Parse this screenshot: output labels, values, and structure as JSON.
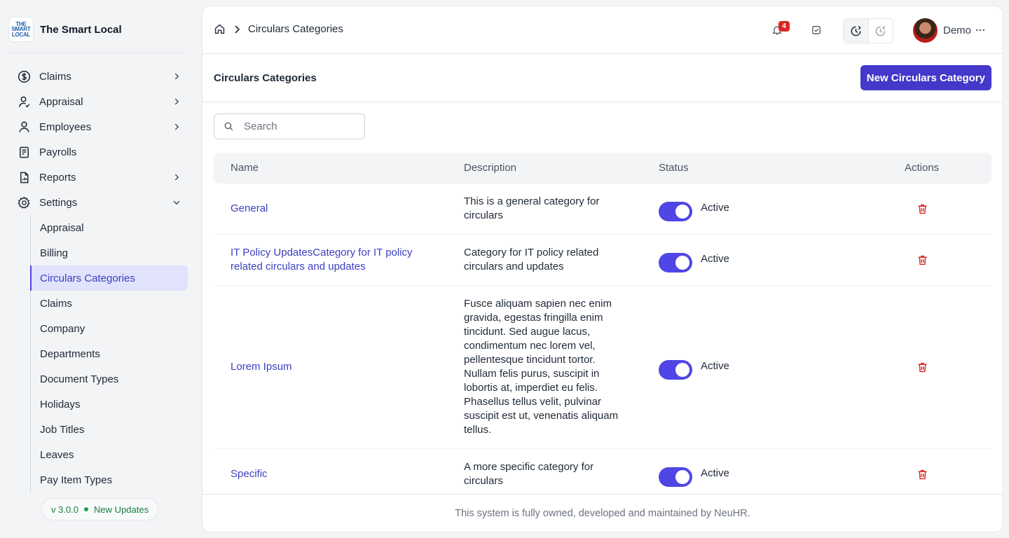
{
  "brand": {
    "logo_text": [
      "THE",
      "SMART",
      "LOCAL"
    ],
    "name": "The Smart Local"
  },
  "sidebar": {
    "items": [
      {
        "label": "Claims",
        "icon": "dollar-circle-icon",
        "chevron": "right"
      },
      {
        "label": "Appraisal",
        "icon": "user-check-icon",
        "chevron": "right"
      },
      {
        "label": "Employees",
        "icon": "user-icon",
        "chevron": "right"
      },
      {
        "label": "Payrolls",
        "icon": "receipt-icon",
        "chevron": ""
      },
      {
        "label": "Reports",
        "icon": "report-file-icon",
        "chevron": "right"
      },
      {
        "label": "Settings",
        "icon": "gear-icon",
        "chevron": "down"
      }
    ],
    "settings_children": [
      "Appraisal",
      "Billing",
      "Circulars Categories",
      "Claims",
      "Company",
      "Departments",
      "Document Types",
      "Holidays",
      "Job Titles",
      "Leaves",
      "Pay Item Types"
    ],
    "active_child": "Circulars Categories",
    "version": "v 3.0.0",
    "updates_label": "New Updates"
  },
  "topbar": {
    "breadcrumb": "Circulars Categories",
    "notification_count": "4",
    "user_name": "Demo"
  },
  "page": {
    "title": "Circulars Categories",
    "new_button": "New Circulars Category",
    "search_placeholder": "Search"
  },
  "table": {
    "columns": [
      "Name",
      "Description",
      "Status",
      "Actions"
    ],
    "rows": [
      {
        "name": "General",
        "description": "This is a general category for circulars",
        "status": "Active"
      },
      {
        "name": "IT Policy UpdatesCategory for IT policy related circulars and updates",
        "description": "Category for IT policy related circulars and updates",
        "status": "Active"
      },
      {
        "name": "Lorem Ipsum",
        "description": "Fusce aliquam sapien nec enim gravida, egestas fringilla enim tincidunt. Sed augue lacus, condimentum nec lorem vel, pellentesque tincidunt tortor. Nullam felis purus, suscipit in lobortis at, imperdiet eu felis. Phasellus tellus velit, pulvinar suscipit est ut, venenatis aliquam tellus.",
        "status": "Active"
      },
      {
        "name": "Specific",
        "description": "A more specific category for circulars",
        "status": "Active"
      }
    ]
  },
  "footer": {
    "text": "This system is fully owned, developed and maintained by NeuHR."
  },
  "colors": {
    "accent": "#4338ca",
    "link": "#3b3fbf",
    "danger": "#dc2626",
    "success": "#16a34a"
  }
}
